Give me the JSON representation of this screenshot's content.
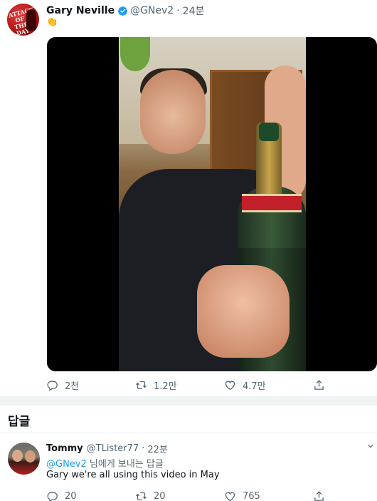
{
  "tweet": {
    "author_name": "Gary Neville",
    "handle": "@GNev2",
    "separator": "·",
    "time": "24분",
    "text": "👏",
    "avatar_logo": "ATTACK OF THE DAY",
    "media": "video",
    "actions": [
      {
        "icon": "reply-icon",
        "count": "2천"
      },
      {
        "icon": "retweet-icon",
        "count": "1.2만"
      },
      {
        "icon": "like-icon",
        "count": "4.7만"
      },
      {
        "icon": "share-icon",
        "count": ""
      }
    ]
  },
  "replies_section": {
    "title": "답글"
  },
  "reply": {
    "author_name": "Tommy",
    "handle": "@TLister77",
    "separator": "·",
    "time": "22분",
    "replying_mention": "@GNev2",
    "replying_suffix": " 님에게 보내는 답글",
    "text": "Gary we're all using this video in May",
    "actions": [
      {
        "icon": "reply-icon",
        "count": "20"
      },
      {
        "icon": "retweet-icon",
        "count": "20"
      },
      {
        "icon": "like-icon",
        "count": "765"
      },
      {
        "icon": "share-icon",
        "count": ""
      }
    ]
  },
  "colors": {
    "accent": "#1d9bf0",
    "muted": "#536471",
    "text": "#0f1419"
  }
}
